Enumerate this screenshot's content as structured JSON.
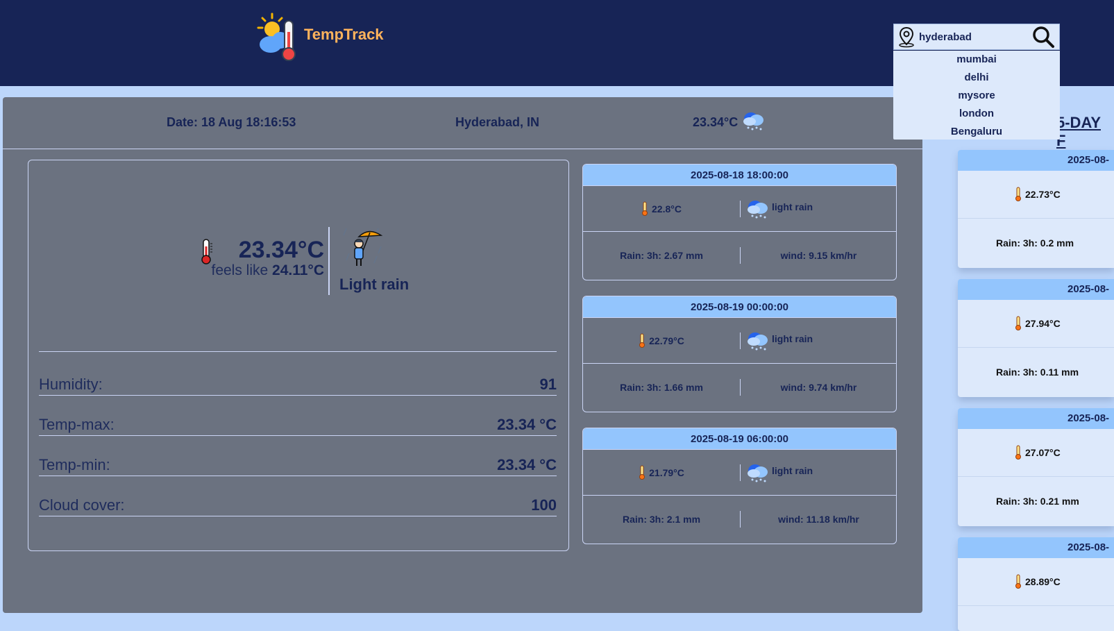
{
  "brand": {
    "name": "TempTrack"
  },
  "search": {
    "value": "hyderabad",
    "suggestions": [
      "mumbai",
      "delhi",
      "mysore",
      "london",
      "Bengaluru"
    ]
  },
  "topbar": {
    "date": "Date: 18 Aug 18:16:53",
    "location": "Hyderabad, IN",
    "temp": "23.34°C"
  },
  "current": {
    "temp": "23.34°C",
    "feels_label": "feels like",
    "feels_value": "24.11°C",
    "description": "Light rain",
    "stats": [
      {
        "label": "Humidity:",
        "value": "91"
      },
      {
        "label": "Temp-max:",
        "value": "23.34 °C"
      },
      {
        "label": "Temp-min:",
        "value": "23.34 °C"
      },
      {
        "label": "Cloud cover:",
        "value": "100"
      }
    ]
  },
  "hourly": [
    {
      "time": "2025-08-18 18:00:00",
      "temp": "22.8°C",
      "desc": "light rain",
      "rain": "Rain:  3h: 2.67 mm",
      "wind": "wind:  9.15 km/hr"
    },
    {
      "time": "2025-08-19 00:00:00",
      "temp": "22.79°C",
      "desc": "light rain",
      "rain": "Rain:  3h: 1.66 mm",
      "wind": "wind:  9.74 km/hr"
    },
    {
      "time": "2025-08-19 06:00:00",
      "temp": "21.79°C",
      "desc": "light rain",
      "rain": "Rain:  3h: 2.1 mm",
      "wind": "wind:  11.18 km/hr"
    }
  ],
  "forecast": {
    "heading": "5-DAY F",
    "days": [
      {
        "date": "2025-08-",
        "temp": "22.73°C",
        "rain": "Rain:  3h: 0.2 mm"
      },
      {
        "date": "2025-08-",
        "temp": "27.94°C",
        "rain": "Rain:  3h: 0.11 mm"
      },
      {
        "date": "2025-08-",
        "temp": "27.07°C",
        "rain": "Rain:  3h: 0.21 mm"
      },
      {
        "date": "2025-08-",
        "temp": "28.89°C",
        "rain": ""
      }
    ]
  },
  "colors": {
    "header_bg": "#172456",
    "brand_text": "#ffb35c",
    "panel_bg": "#6b7280",
    "accent_blue": "#93c5fd",
    "page_bg": "#bcd6fb"
  },
  "icons": [
    "sun-cloud-thermometer-logo",
    "location-pin-icon",
    "search-icon",
    "thermometer-icon",
    "rain-cloud-icon",
    "umbrella-person-icon"
  ]
}
